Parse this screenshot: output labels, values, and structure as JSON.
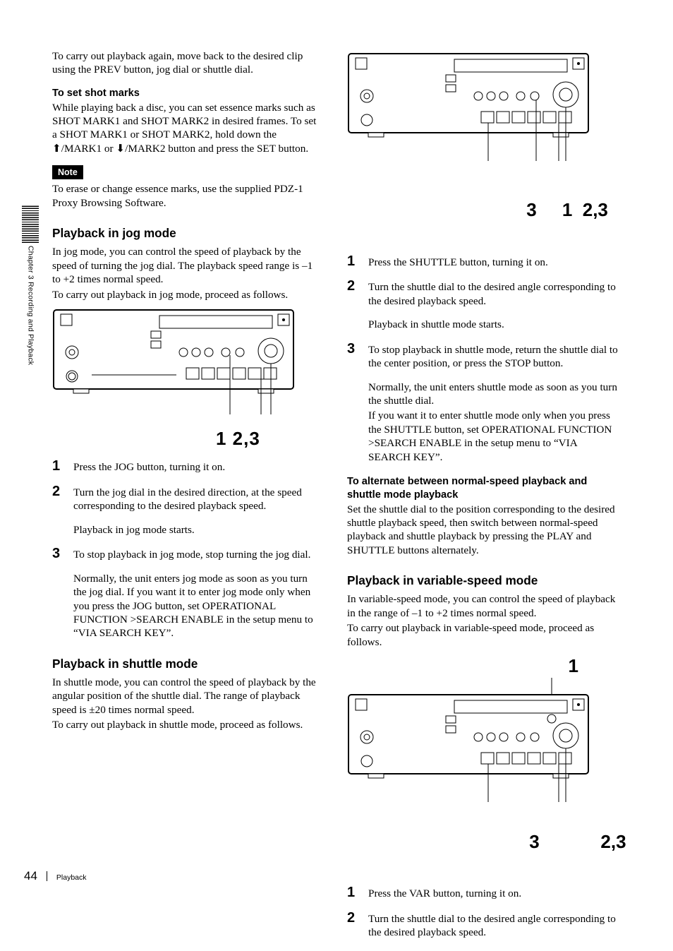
{
  "sidebar_label": "Chapter 3  Recording and Playback",
  "footer": {
    "page_number": "44",
    "section": "Playback"
  },
  "left": {
    "intro_again": "To carry out playback again, move back to the desired clip using the PREV button, jog dial or shuttle dial.",
    "shot_marks_heading": "To set shot marks",
    "shot_marks_p1": "While playing back a disc, you can set essence marks such as SHOT MARK1 and SHOT MARK2 in desired frames. To set a SHOT MARK1 or SHOT MARK2, hold down the ",
    "shot_marks_mark1": "/MARK1 or ",
    "shot_marks_mark2": "/MARK2 button and press the SET button.",
    "note_label": "Note",
    "note_text": "To erase or change essence marks, use the supplied PDZ-1 Proxy Browsing Software.",
    "jog_heading": "Playback in jog mode",
    "jog_intro": "In jog mode, you can control the speed of playback by the speed of turning the jog dial. The playback speed range is –1 to +2 times normal speed.",
    "jog_intro2": "To carry out playback in jog mode, proceed as follows.",
    "jog_callouts": "1  2,3",
    "jog_steps": {
      "s1": "Press the JOG button, turning it on.",
      "s2": "Turn the jog dial in the desired direction, at the speed corresponding to the desired playback speed.",
      "s2b": "Playback in jog mode starts.",
      "s3": "To stop playback in jog mode, stop turning the jog dial.",
      "s3b": "Normally, the unit enters jog mode as soon as you turn the jog dial. If you want it to enter jog mode only when you press the JOG button, set OPERATIONAL FUNCTION >SEARCH ENABLE in the setup menu to “VIA SEARCH KEY”."
    },
    "shuttle_heading": "Playback in shuttle mode",
    "shuttle_intro": "In shuttle mode, you can control the speed of playback by the angular position of the shuttle dial. The range of playback speed is ±20 times normal speed.",
    "shuttle_intro2": "To carry out playback in shuttle mode, proceed as follows."
  },
  "right": {
    "shuttle_callouts": "3     1  2,3",
    "shuttle_steps": {
      "s1": "Press the SHUTTLE button, turning it on.",
      "s2": "Turn the shuttle dial to the desired angle corresponding to the desired playback speed.",
      "s2b": "Playback in shuttle mode starts.",
      "s3": "To stop playback in shuttle mode, return the shuttle dial to the center position, or press the STOP button.",
      "s3b": "Normally, the unit enters shuttle mode as soon as you turn the shuttle dial.",
      "s3c": "If you want it to enter shuttle mode only when you press the SHUTTLE button, set OPERATIONAL FUNCTION >SEARCH ENABLE in the setup menu to “VIA SEARCH KEY”."
    },
    "alt_heading": "To alternate between normal-speed playback and shuttle mode playback",
    "alt_text": "Set the shuttle dial to the position corresponding to the desired shuttle playback speed, then switch between normal-speed playback and shuttle playback by pressing the PLAY and SHUTTLE buttons alternately.",
    "var_heading": "Playback in variable-speed mode",
    "var_intro": "In variable-speed mode, you can control the speed of playback in the range of –1 to +2 times normal speed.",
    "var_intro2": "To carry out playback in variable-speed mode, proceed as follows.",
    "var_top_callout": "1",
    "var_bottom_callouts": "3            2,3",
    "var_steps": {
      "s1": "Press the VAR button, turning it on.",
      "s2": "Turn the shuttle dial to the desired angle corresponding to the desired playback speed."
    }
  }
}
